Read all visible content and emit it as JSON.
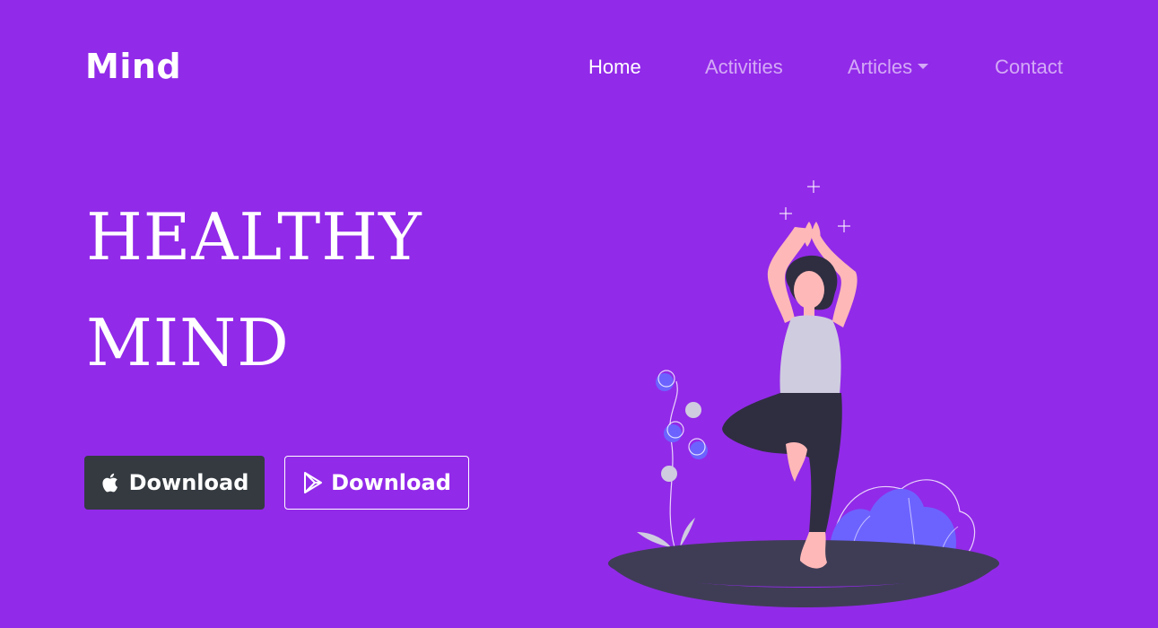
{
  "brand": {
    "name": "Mind"
  },
  "nav": {
    "items": [
      {
        "label": "Home",
        "active": true
      },
      {
        "label": "Activities",
        "active": false
      },
      {
        "label": "Articles",
        "active": false,
        "dropdown": true
      },
      {
        "label": "Contact",
        "active": false
      }
    ]
  },
  "hero": {
    "line1": "HEALTHY",
    "line2": "MIND"
  },
  "buttons": {
    "apple": {
      "label": "Download",
      "icon": "apple-icon"
    },
    "play": {
      "label": "Download",
      "icon": "play-store-icon"
    }
  },
  "colors": {
    "background": "#922ae9",
    "button_dark": "#343a40",
    "ground": "#3f3d56",
    "accent": "#6c63ff",
    "skin": "#ffb8b8",
    "top": "#cfcce0",
    "hair": "#2f2e41"
  }
}
